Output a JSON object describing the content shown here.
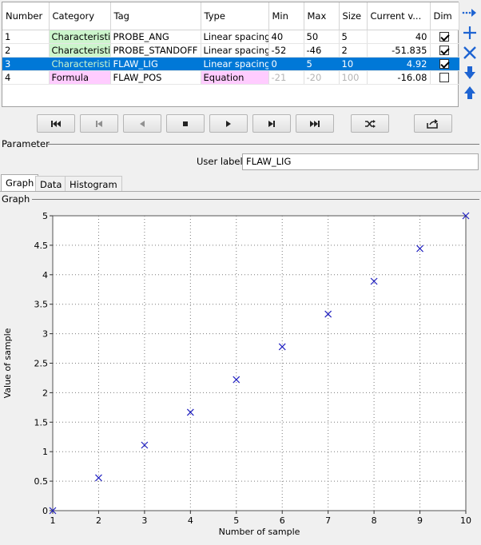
{
  "table": {
    "headers": [
      "Number",
      "Category",
      "Tag",
      "Type",
      "Min",
      "Max",
      "Size",
      "Current v...",
      "Dim"
    ],
    "rows": [
      {
        "number": "1",
        "category": "Characteristic",
        "tag": "PROBE_ANG",
        "type": "Linear spacing",
        "min": "40",
        "max": "50",
        "size": "5",
        "current": "40",
        "dim_checked": true,
        "selected": false
      },
      {
        "number": "2",
        "category": "Characteristic",
        "tag": "PROBE_STANDOFF",
        "type": "Linear spacing",
        "min": "-52",
        "max": "-46",
        "size": "2",
        "current": "-51.835",
        "dim_checked": true,
        "selected": false
      },
      {
        "number": "3",
        "category": "Characteristic",
        "tag": "FLAW_LIG",
        "type": "Linear spacing",
        "min": "0",
        "max": "5",
        "size": "10",
        "current": "4.92",
        "dim_checked": true,
        "selected": true
      },
      {
        "number": "4",
        "category": "Formula",
        "tag": "FLAW_POS",
        "type": "Equation",
        "min": "-21",
        "max": "-20",
        "size": "100",
        "current": "-16.08",
        "dim_checked": false,
        "selected": false
      }
    ]
  },
  "side_tools": [
    "arrow-right-dotted-icon",
    "plus-icon",
    "delete-x-icon",
    "arrow-down-icon",
    "arrow-up-icon"
  ],
  "transport": [
    "first-icon",
    "prev-step-icon",
    "back-icon",
    "stop-icon",
    "play-icon",
    "next-step-icon",
    "last-icon",
    "shuffle-icon",
    "export-icon"
  ],
  "parameter": {
    "group_label": "Parameter",
    "user_label_text": "User label",
    "user_label_value": "FLAW_LIG"
  },
  "tabs": [
    "Graph",
    "Data",
    "Histogram"
  ],
  "graph_group_label": "Graph",
  "colors": {
    "characteristic_bg": "#ccf5cc",
    "formula_bg": "#ffccff",
    "selection": "#0078d7",
    "marker": "#2020c0",
    "toolbar_icon": "#1e64d2"
  },
  "chart_data": {
    "type": "scatter",
    "xlabel": "Number of sample",
    "ylabel": "Value of sample",
    "xlim": [
      1,
      10
    ],
    "ylim": [
      0,
      5
    ],
    "x_ticks": [
      "1",
      "2",
      "3",
      "4",
      "5",
      "6",
      "7",
      "8",
      "9",
      "10"
    ],
    "y_ticks": [
      "0",
      "0.5",
      "1",
      "1.5",
      "2",
      "2.5",
      "3",
      "3.5",
      "4",
      "4.5",
      "5"
    ],
    "grid": true,
    "marker": "x",
    "x": [
      1,
      2,
      3,
      4,
      5,
      6,
      7,
      8,
      9,
      10
    ],
    "y": [
      0,
      0.556,
      1.111,
      1.667,
      2.222,
      2.778,
      3.333,
      3.889,
      4.444,
      5
    ]
  }
}
